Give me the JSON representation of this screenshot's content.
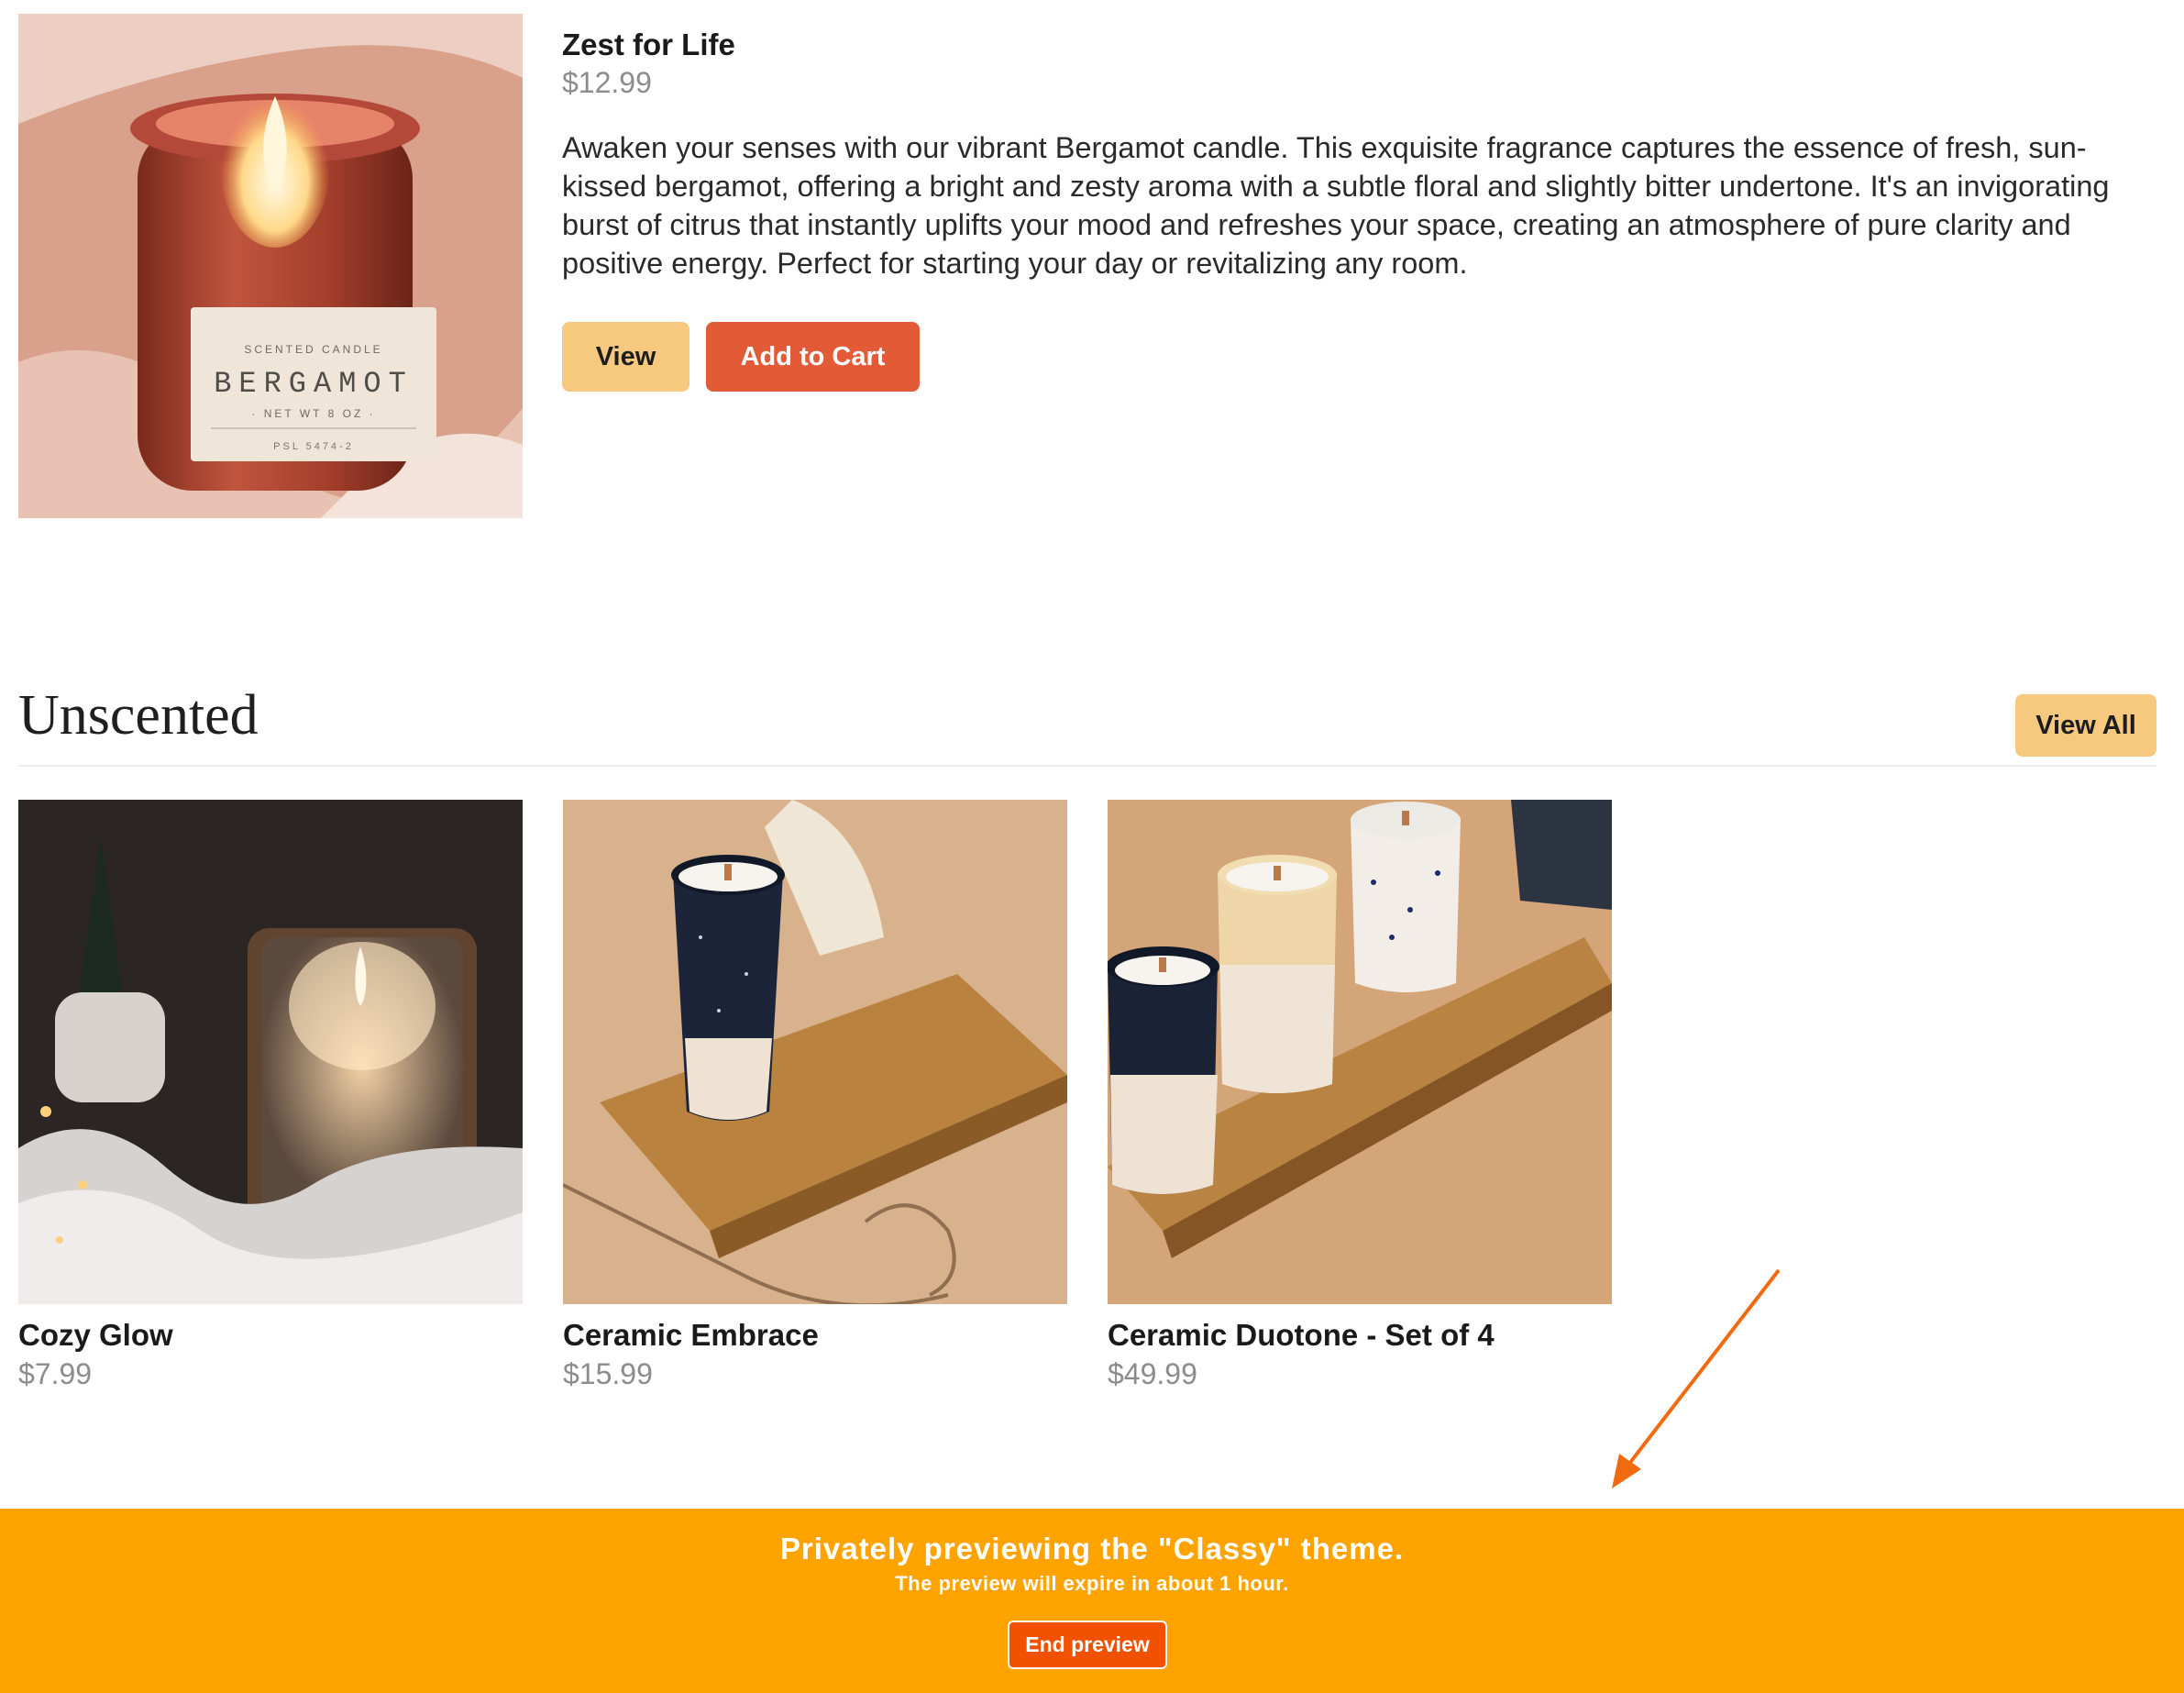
{
  "featured": {
    "title": "Zest for Life",
    "price": "$12.99",
    "description": "Awaken your senses with our vibrant Bergamot candle. This exquisite fragrance captures the essence of fresh, sun-kissed bergamot, offering a bright and zesty aroma with a subtle floral and slightly bitter undertone. It's an invigorating burst of citrus that instantly uplifts your mood and refreshes your space, creating an atmosphere of pure clarity and positive energy. Perfect for starting your day or revitalizing any room.",
    "view_label": "View",
    "cart_label": "Add to Cart",
    "image_label_small": "SCENTED CANDLE",
    "image_label_main": "BERGAMOT",
    "image_label_weight": "· NET WT 8 OZ ·",
    "image_label_code": "PSL 5474-2"
  },
  "section": {
    "title": "Unscented",
    "view_all_label": "View All"
  },
  "products": [
    {
      "name": "Cozy Glow",
      "price": "$7.99"
    },
    {
      "name": "Ceramic Embrace",
      "price": "$15.99"
    },
    {
      "name": "Ceramic Duotone - Set of 4",
      "price": "$49.99"
    }
  ],
  "preview_banner": {
    "title": "Privately previewing the \"Classy\" theme.",
    "subtitle": "The preview will expire in about 1 hour.",
    "end_label": "End preview"
  },
  "colors": {
    "accent_yellow": "#f7c97e",
    "cart_red": "#e35b36",
    "banner_orange": "#ffa300",
    "end_button": "#f25100",
    "arrow": "#f26a10"
  }
}
